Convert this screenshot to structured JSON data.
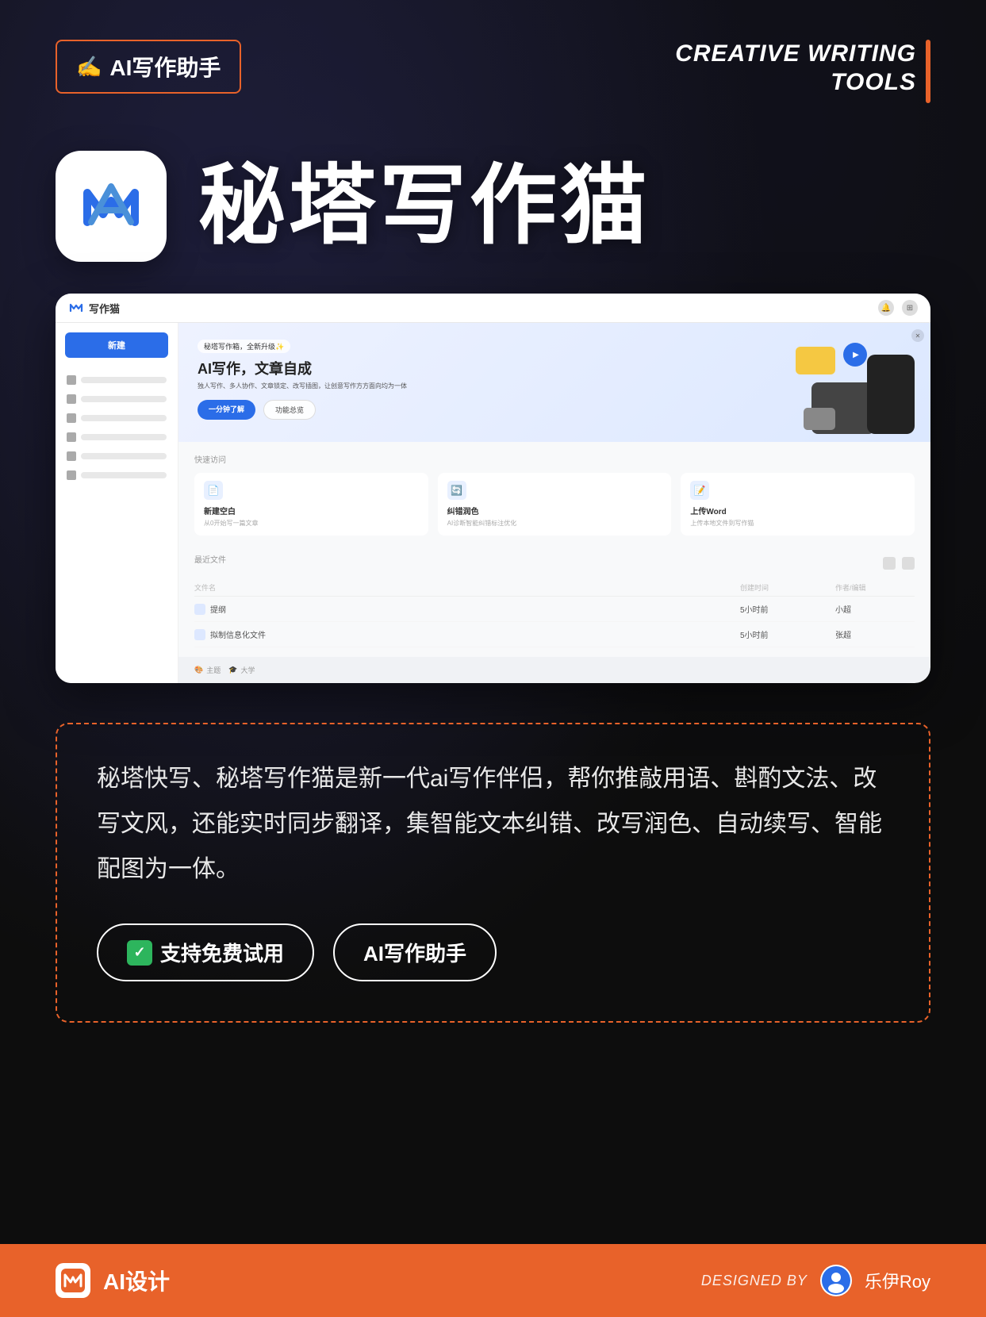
{
  "header": {
    "top_label": "AI写作助手",
    "hand_icon": "✍️",
    "creative_writing_line1": "CREATIVE WRITING",
    "creative_writing_line2": "TOOLS"
  },
  "hero": {
    "app_title": "秘塔写作猫",
    "app_icon_alt": "AI Logo"
  },
  "screenshot": {
    "app_name": "写作猫",
    "banner": {
      "badge": "秘塔写作箱，全新升级✨",
      "title_main": "AI写作，文章自成",
      "desc": "独人写作、多人协作、文章锁定、改写插图，让创意写作方方面向均为一体",
      "btn_primary": "一分钟了解",
      "btn_secondary": "功能总览"
    },
    "quick_actions_label": "快速访问",
    "quick_actions": [
      {
        "title": "新建空白",
        "desc": "从0开始写一篇文章"
      },
      {
        "title": "纠错润色",
        "desc": "AI诊断智能纠错标注优化"
      },
      {
        "title": "上传Word",
        "desc": "上传本地文件到写作猫"
      }
    ],
    "recent_label": "最近文件",
    "table_headers": [
      "文件名",
      "创建时间",
      "作者/编辑"
    ],
    "recent_files": [
      {
        "name": "提纲",
        "created": "5小时前",
        "editor": "小超"
      },
      {
        "name": "拟制信息化文件",
        "created": "5小时前",
        "editor": "张超"
      }
    ],
    "footer_items": [
      "主题",
      "大学"
    ]
  },
  "description": {
    "text": "秘塔快写、秘塔写作猫是新一代ai写作伴侣，帮你推敲用语、斟酌文法、改写文风，还能实时同步翻译，集智能文本纠错、改写润色、自动续写、智能配图为一体。",
    "btn_trial": "支持免费试用",
    "btn_ai": "AI写作助手",
    "check_icon": "✓"
  },
  "footer": {
    "left_label": "AI设计",
    "designed_by": "DESIGNED BY",
    "author": "乐伊Roy"
  }
}
